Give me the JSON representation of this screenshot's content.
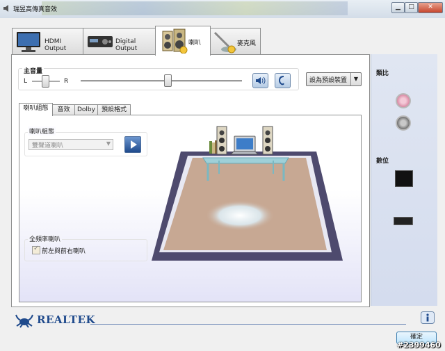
{
  "window": {
    "title": "瑞昱高傳真音效"
  },
  "device_tabs": [
    {
      "label": "HDMI Output"
    },
    {
      "label": "Digital Output"
    },
    {
      "label": "喇叭"
    },
    {
      "label": "麥克風"
    }
  ],
  "master_volume": {
    "title": "主音量",
    "balance_left": "L",
    "balance_right": "R",
    "default_device_label": "設為預設裝置"
  },
  "sub_tabs": [
    {
      "label": "喇叭組態"
    },
    {
      "label": "音效"
    },
    {
      "label": "Dolby"
    },
    {
      "label": "預設格式"
    }
  ],
  "speaker_config": {
    "group_label": "喇叭組態",
    "selected": "雙聲道喇叭"
  },
  "fullrange": {
    "group_label": "全頻率喇叭",
    "option_label": "前左與前右喇叭",
    "checked": true
  },
  "sidebar": {
    "analog_title": "類比",
    "digital_title": "數位"
  },
  "footer": {
    "brand": "REALTEK",
    "ok_label": "確定",
    "watermark": "#2399460"
  },
  "colors": {
    "accent": "#1f4a8c",
    "floor": "#c7a893",
    "frame": "#4e4a6e"
  }
}
